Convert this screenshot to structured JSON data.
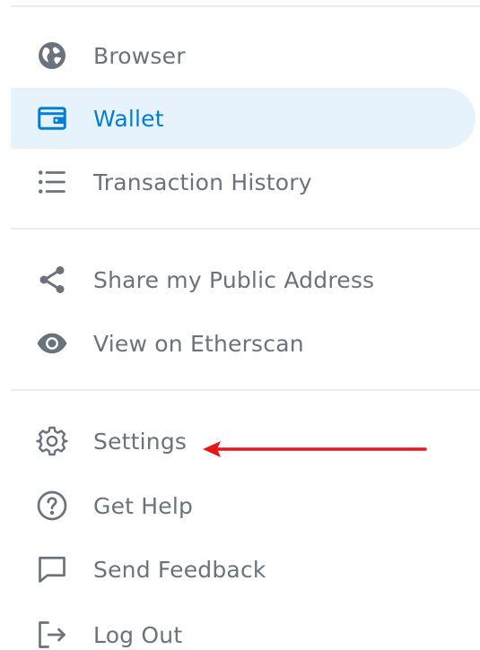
{
  "menu": {
    "group1": [
      {
        "label": "Browser",
        "icon": "globe-icon"
      },
      {
        "label": "Wallet",
        "icon": "wallet-icon",
        "selected": true
      },
      {
        "label": "Transaction History",
        "icon": "list-icon"
      }
    ],
    "group2": [
      {
        "label": "Share my Public Address",
        "icon": "share-icon"
      },
      {
        "label": "View on Etherscan",
        "icon": "eye-icon"
      }
    ],
    "group3": [
      {
        "label": "Settings",
        "icon": "gear-icon"
      },
      {
        "label": "Get Help",
        "icon": "help-circle-icon"
      },
      {
        "label": "Send Feedback",
        "icon": "chat-bubble-icon"
      },
      {
        "label": "Log Out",
        "icon": "logout-icon"
      }
    ]
  },
  "colors": {
    "text": "#6a737d",
    "accent": "#037dd6",
    "selected_bg": "#e6f2fc",
    "divider": "#ececec",
    "annotation": "#e8151b"
  }
}
